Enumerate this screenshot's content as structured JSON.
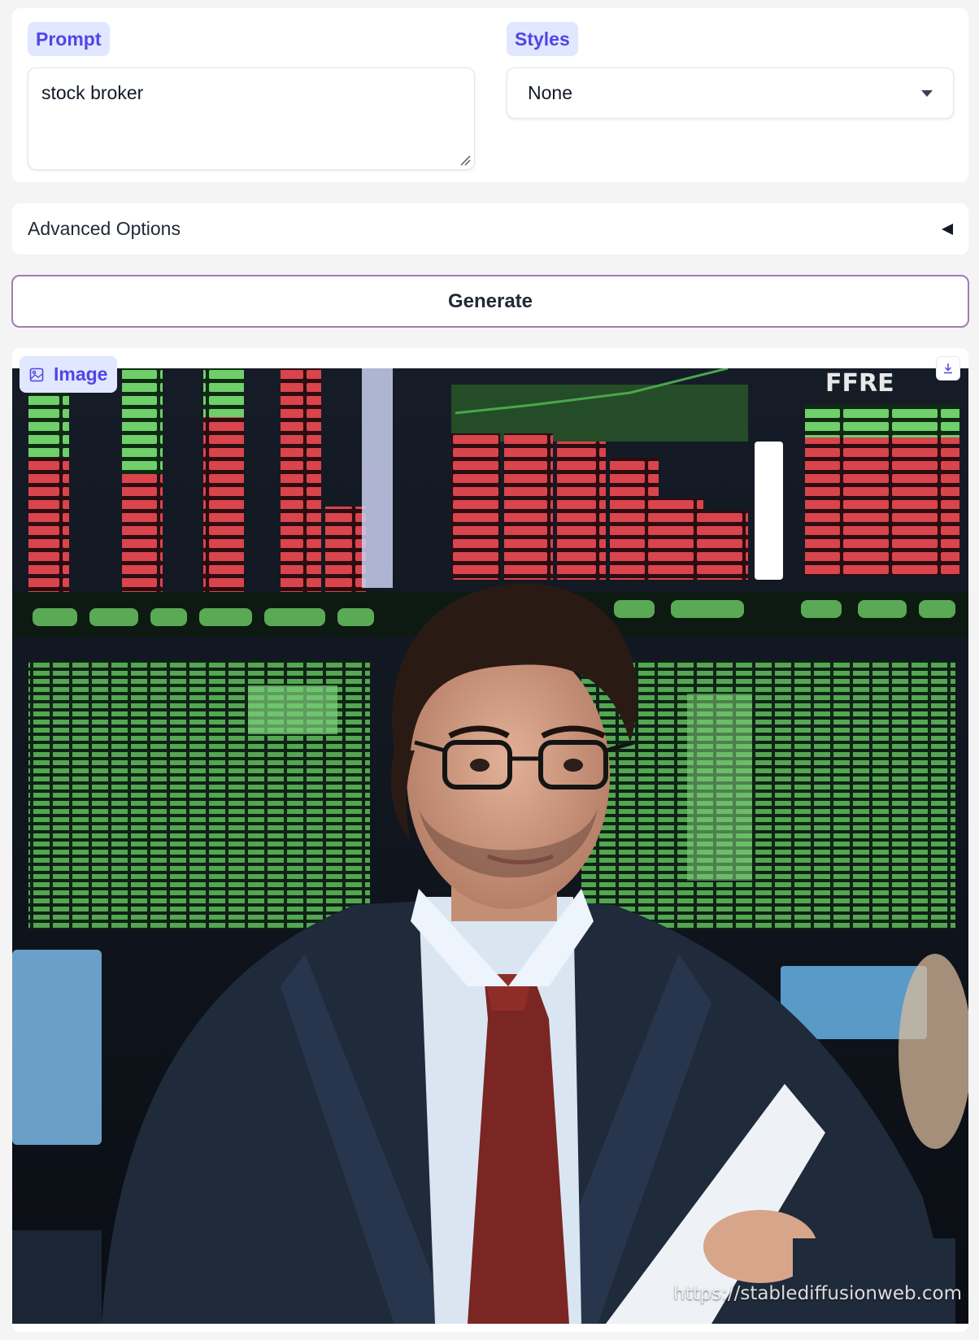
{
  "prompt": {
    "label": "Prompt",
    "value": "stock broker"
  },
  "styles": {
    "label": "Styles",
    "selected": "None"
  },
  "advanced": {
    "label": "Advanced Options"
  },
  "generate": {
    "label": "Generate"
  },
  "output": {
    "label": "Image",
    "watermark": "https://stablediffusionweb.com"
  },
  "colors": {
    "accent": "#4f46e5",
    "chip_bg": "#e0e7ff",
    "generate_border": "#a27bb5"
  },
  "icons": {
    "image_label": "image-icon",
    "download": "download-icon",
    "dropdown": "caret-down-icon",
    "accordion": "triangle-left-icon"
  }
}
